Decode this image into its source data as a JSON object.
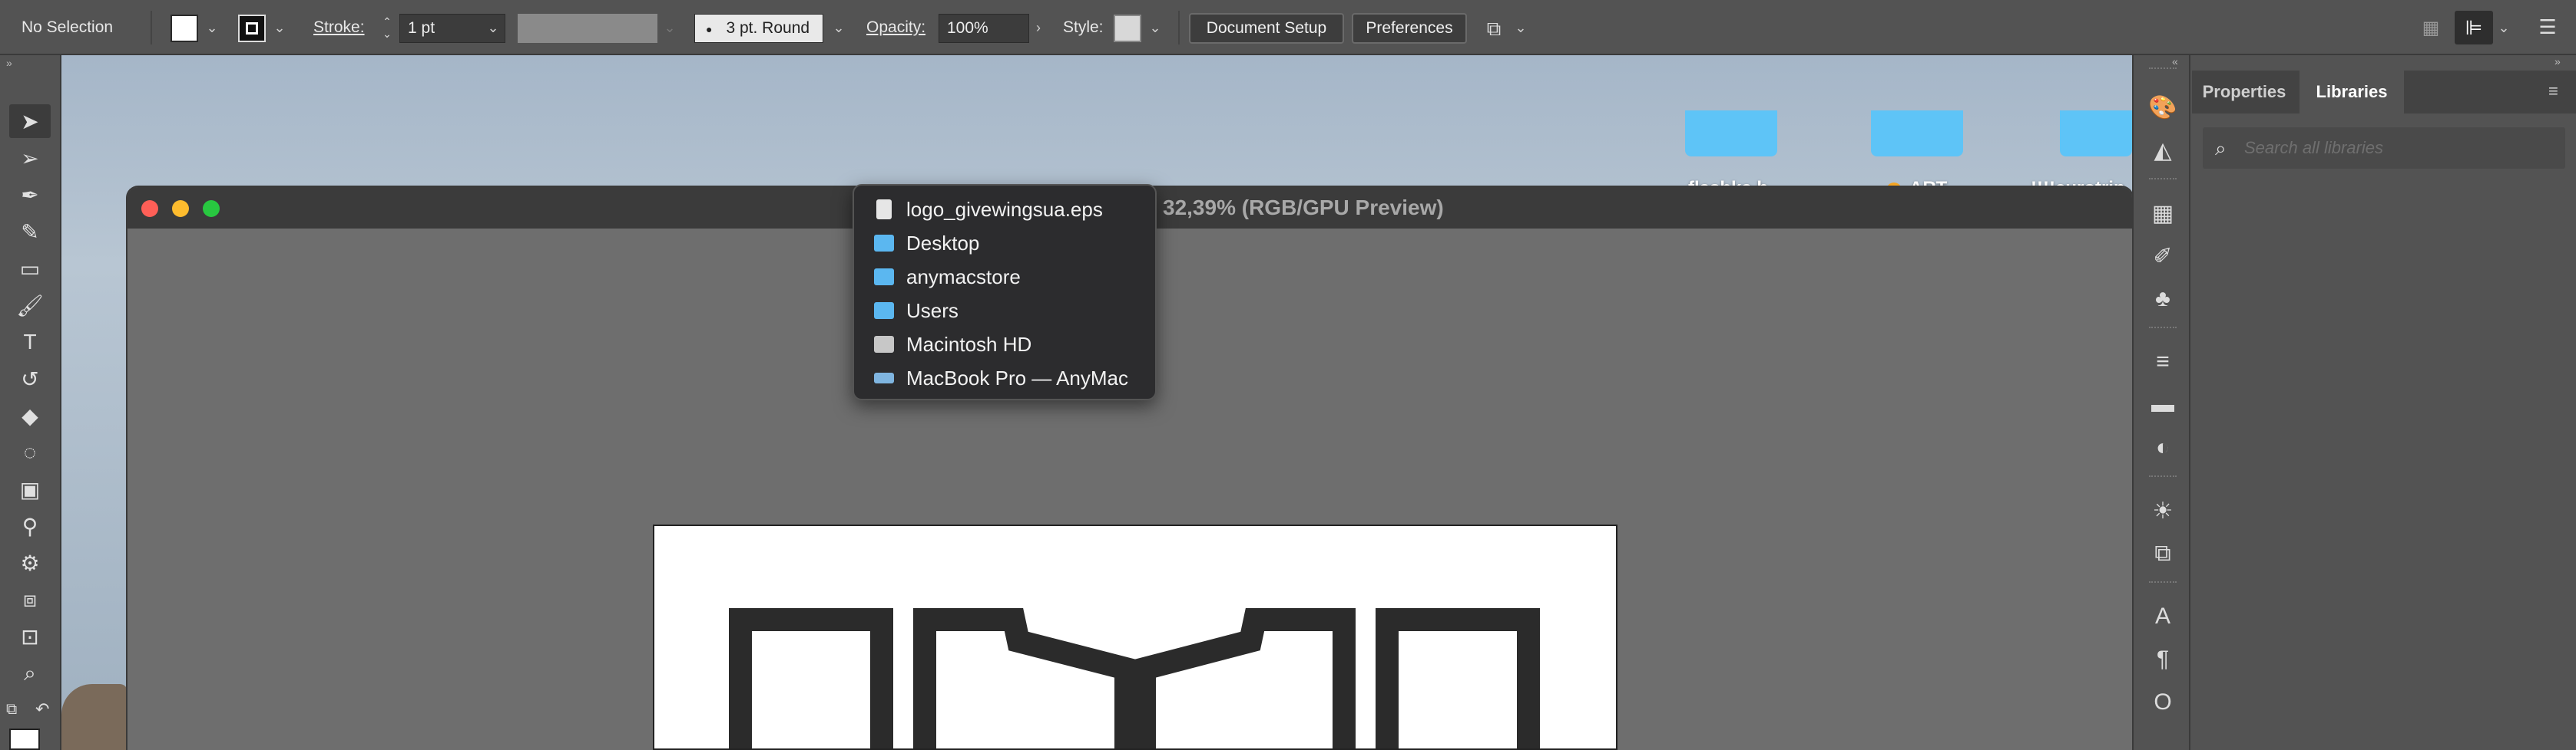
{
  "controlbar": {
    "selection_label": "No Selection",
    "stroke_label": "Stroke:",
    "stroke_weight": "1 pt",
    "brush_label": "3 pt. Round",
    "opacity_label": "Opacity:",
    "opacity_value": "100%",
    "style_label": "Style:",
    "document_setup": "Document Setup",
    "preferences": "Preferences"
  },
  "document": {
    "title": "32,39% (RGB/GPU Preview)"
  },
  "popup_menu": {
    "items": [
      {
        "label": "logo_givewingsua.eps",
        "icon": "document-icon"
      },
      {
        "label": "Desktop",
        "icon": "folder-icon"
      },
      {
        "label": "anymacstore",
        "icon": "folder-icon"
      },
      {
        "label": "Users",
        "icon": "folder-icon"
      },
      {
        "label": "Macintosh HD",
        "icon": "hard-drive-icon"
      },
      {
        "label": "MacBook Pro — AnyMac",
        "icon": "laptop-icon"
      }
    ]
  },
  "desktop": {
    "items": [
      {
        "label": "flashka b"
      },
      {
        "label": "ART"
      },
      {
        "label": "!!!!eurotrip"
      }
    ]
  },
  "panel": {
    "tabs": [
      {
        "label": "Properties"
      },
      {
        "label": "Libraries"
      }
    ],
    "search_placeholder": "Search all libraries"
  },
  "colors": {
    "folder": "#5ec4f7",
    "close": "#ff5f57",
    "minimize": "#febc2e",
    "zoom": "#28c840",
    "tag_orange": "#f5a623"
  }
}
